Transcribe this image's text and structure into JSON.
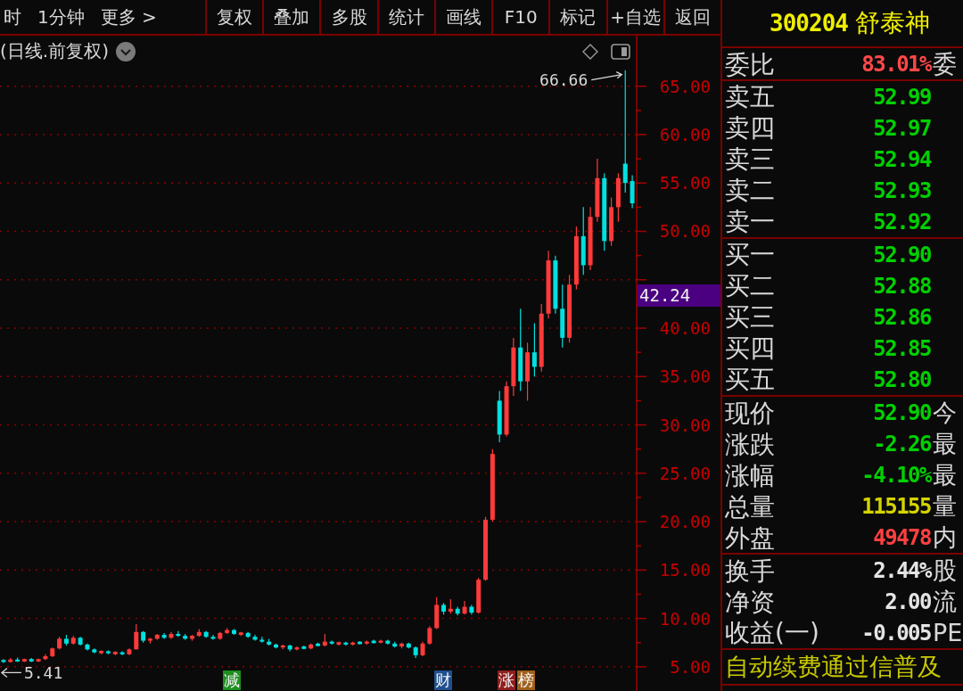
{
  "toolbar": {
    "periods": [
      {
        "label": "时"
      },
      {
        "label": "1分钟"
      },
      {
        "label": "更多 >"
      }
    ],
    "buttons": [
      "复权",
      "叠加",
      "多股",
      "统计",
      "画线",
      "F10",
      "标记",
      "+自选",
      "返回"
    ]
  },
  "chart": {
    "title": "(日线.前复权)",
    "cursor_price": "42.24",
    "event_tags": [
      {
        "label": "减",
        "color": "#1f8f1f"
      },
      {
        "label": "财",
        "color": "#1f4f8f"
      },
      {
        "label": "涨",
        "color": "#8f1f1f"
      },
      {
        "label": "榜",
        "color": "#a0601a"
      }
    ],
    "chart_data": [
      {
        "type": "candlestick",
        "ylim": [
          2.5,
          67
        ],
        "yticks": [
          {
            "value": 5,
            "label": "5.00"
          },
          {
            "value": 10,
            "label": "10.00"
          },
          {
            "value": 15,
            "label": "15.00"
          },
          {
            "value": 20,
            "label": "20.00"
          },
          {
            "value": 25,
            "label": "25.00"
          },
          {
            "value": 30,
            "label": "30.00"
          },
          {
            "value": 35,
            "label": "35.00"
          },
          {
            "value": 40,
            "label": "40.00"
          },
          {
            "value": 50,
            "label": "50.00"
          },
          {
            "value": 55,
            "label": "55.00"
          },
          {
            "value": 60,
            "label": "60.00"
          },
          {
            "value": 65,
            "label": "65.00"
          }
        ],
        "tick_labels": "y",
        "grid": true,
        "annotations": [
          "66.66",
          "5.41"
        ],
        "ohlc": [
          [
            5.7,
            5.8,
            5.41,
            5.5
          ],
          [
            5.5,
            5.9,
            5.45,
            5.75
          ],
          [
            5.75,
            5.95,
            5.5,
            5.55
          ],
          [
            5.55,
            5.85,
            5.5,
            5.8
          ],
          [
            5.8,
            5.9,
            5.5,
            5.55
          ],
          [
            5.55,
            5.85,
            5.5,
            5.8
          ],
          [
            5.8,
            6.3,
            5.7,
            6.1
          ],
          [
            6.1,
            7.0,
            6.0,
            6.9
          ],
          [
            6.9,
            8.1,
            6.8,
            7.9
          ],
          [
            7.9,
            8.3,
            7.2,
            7.4
          ],
          [
            7.4,
            8.2,
            7.3,
            8.0
          ],
          [
            8.0,
            8.1,
            7.2,
            7.3
          ],
          [
            7.3,
            7.4,
            6.7,
            6.8
          ],
          [
            6.8,
            6.9,
            6.4,
            6.5
          ],
          [
            6.4,
            6.7,
            6.3,
            6.65
          ],
          [
            6.6,
            6.7,
            6.3,
            6.4
          ],
          [
            6.3,
            6.6,
            6.2,
            6.55
          ],
          [
            6.5,
            6.6,
            6.2,
            6.3
          ],
          [
            6.3,
            6.9,
            6.2,
            6.8
          ],
          [
            6.8,
            9.4,
            6.8,
            8.6
          ],
          [
            8.6,
            8.7,
            7.5,
            7.7
          ],
          [
            7.7,
            8.0,
            7.4,
            7.9
          ],
          [
            7.9,
            8.4,
            7.8,
            8.3
          ],
          [
            8.3,
            8.5,
            7.9,
            8.0
          ],
          [
            8.0,
            8.6,
            7.9,
            8.4
          ],
          [
            8.4,
            8.7,
            8.1,
            8.2
          ],
          [
            8.2,
            8.4,
            7.8,
            7.9
          ],
          [
            7.9,
            8.3,
            7.7,
            8.2
          ],
          [
            8.2,
            8.9,
            8.1,
            8.6
          ],
          [
            8.6,
            8.7,
            8.0,
            8.1
          ],
          [
            8.1,
            8.3,
            7.8,
            7.9
          ],
          [
            7.9,
            8.6,
            7.8,
            8.5
          ],
          [
            8.5,
            9.0,
            8.4,
            8.8
          ],
          [
            8.8,
            8.9,
            8.3,
            8.4
          ],
          [
            8.3,
            8.6,
            8.2,
            8.55
          ],
          [
            8.5,
            8.6,
            8.0,
            8.1
          ],
          [
            8.1,
            8.3,
            7.7,
            7.8
          ],
          [
            7.8,
            8.1,
            7.5,
            7.6
          ],
          [
            7.6,
            7.9,
            7.2,
            7.3
          ],
          [
            7.3,
            7.4,
            6.9,
            7.0
          ],
          [
            7.0,
            7.3,
            6.8,
            7.2
          ],
          [
            7.2,
            7.3,
            6.6,
            6.8
          ],
          [
            6.8,
            7.1,
            6.7,
            7.0
          ],
          [
            7.1,
            7.2,
            6.8,
            6.85
          ],
          [
            6.9,
            7.4,
            6.8,
            7.3
          ],
          [
            7.4,
            7.5,
            7.1,
            7.15
          ],
          [
            7.2,
            8.4,
            7.1,
            7.6
          ],
          [
            7.6,
            7.7,
            7.3,
            7.4
          ],
          [
            7.3,
            7.6,
            7.2,
            7.55
          ],
          [
            7.5,
            7.6,
            7.2,
            7.3
          ],
          [
            7.3,
            7.6,
            7.2,
            7.5
          ],
          [
            7.6,
            7.65,
            7.3,
            7.35
          ],
          [
            7.4,
            7.7,
            7.3,
            7.6
          ],
          [
            7.7,
            7.8,
            7.4,
            7.45
          ],
          [
            7.5,
            7.8,
            7.4,
            7.7
          ],
          [
            7.7,
            7.8,
            7.3,
            7.4
          ],
          [
            7.4,
            7.6,
            7.0,
            7.1
          ],
          [
            7.1,
            7.5,
            6.9,
            7.4
          ],
          [
            7.4,
            7.5,
            6.9,
            7.0
          ],
          [
            7.0,
            7.1,
            5.9,
            6.2
          ],
          [
            6.2,
            7.6,
            6.1,
            7.4
          ],
          [
            7.4,
            9.2,
            7.3,
            9.0
          ],
          [
            9.0,
            12.2,
            8.9,
            11.4
          ],
          [
            11.4,
            11.6,
            10.4,
            10.7
          ],
          [
            10.7,
            12.0,
            10.5,
            11.0
          ],
          [
            11.0,
            11.2,
            10.3,
            10.5
          ],
          [
            10.5,
            11.8,
            10.4,
            11.2
          ],
          [
            11.2,
            11.4,
            10.4,
            10.6
          ],
          [
            10.6,
            14.2,
            10.5,
            14.0
          ],
          [
            14.0,
            20.5,
            13.9,
            20.2
          ],
          [
            20.2,
            27.5,
            20.0,
            27.0
          ],
          [
            32.5,
            33.5,
            28.2,
            29.0
          ],
          [
            29.0,
            34.5,
            28.8,
            34.0
          ],
          [
            34.0,
            39.0,
            33.0,
            38.0
          ],
          [
            38.0,
            42.0,
            33.5,
            34.5
          ],
          [
            34.5,
            38.5,
            32.5,
            37.5
          ],
          [
            37.5,
            40.5,
            35.0,
            36.0
          ],
          [
            36.0,
            42.5,
            35.5,
            41.5
          ],
          [
            41.5,
            48.0,
            41.0,
            47.0
          ],
          [
            47.0,
            47.5,
            41.5,
            42.0
          ],
          [
            42.0,
            44.5,
            38.0,
            39.0
          ],
          [
            39.0,
            45.5,
            38.5,
            44.5
          ],
          [
            44.5,
            50.5,
            44.0,
            49.5
          ],
          [
            49.5,
            52.5,
            45.5,
            46.5
          ],
          [
            46.5,
            52.5,
            46.0,
            51.5
          ],
          [
            51.5,
            57.5,
            51.0,
            55.5
          ],
          [
            55.5,
            56.0,
            48.0,
            49.0
          ],
          [
            49.0,
            53.5,
            48.5,
            52.5
          ],
          [
            52.5,
            56.0,
            51.0,
            55.5
          ],
          [
            57.0,
            66.66,
            54.0,
            55.0
          ],
          [
            55.2,
            55.8,
            52.4,
            52.9
          ]
        ]
      }
    ]
  },
  "quote_panel": {
    "code": "300204",
    "name": "舒泰神",
    "ratio": {
      "label": "委比",
      "value": "83.01%",
      "side_label": "委"
    },
    "sell": [
      {
        "label": "卖五",
        "price": "52.99"
      },
      {
        "label": "卖四",
        "price": "52.97"
      },
      {
        "label": "卖三",
        "price": "52.94"
      },
      {
        "label": "卖二",
        "price": "52.93"
      },
      {
        "label": "卖一",
        "price": "52.92"
      }
    ],
    "buy": [
      {
        "label": "买一",
        "price": "52.90"
      },
      {
        "label": "买二",
        "price": "52.88"
      },
      {
        "label": "买三",
        "price": "52.86"
      },
      {
        "label": "买四",
        "price": "52.85"
      },
      {
        "label": "买五",
        "price": "52.80"
      }
    ],
    "stats": [
      {
        "label": "现价",
        "value": "52.90",
        "color": "#00d000",
        "side_label": "今"
      },
      {
        "label": "涨跌",
        "value": "-2.26",
        "color": "#00d000",
        "side_label": "最"
      },
      {
        "label": "涨幅",
        "value": "-4.10%",
        "color": "#00d000",
        "side_label": "最"
      },
      {
        "label": "总量",
        "value": "115155",
        "color": "#d4d400",
        "side_label": "量"
      },
      {
        "label": "外盘",
        "value": "49478",
        "color": "#ff4040",
        "side_label": "内"
      }
    ],
    "fundamentals": [
      {
        "label": "换手",
        "value": "2.44%",
        "side_label": "股"
      },
      {
        "label": "净资",
        "value": "2.00",
        "side_label": "流"
      },
      {
        "label": "收益(一)",
        "value": "-0.005",
        "side_label": "PE"
      }
    ],
    "ticker": "自动续费通过信普及"
  }
}
